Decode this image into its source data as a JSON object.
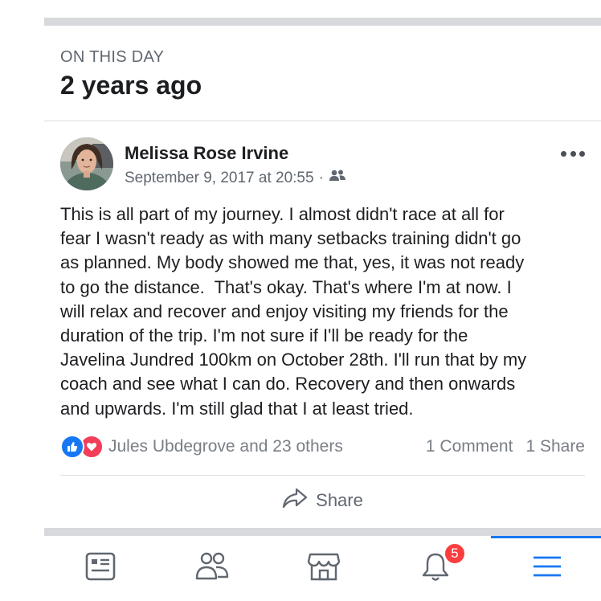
{
  "section": {
    "label": "ON THIS DAY",
    "title": "2 years ago"
  },
  "post": {
    "author": "Melissa Rose Irvine",
    "timestamp": "September 9, 2017 at 20:55",
    "separator": "·",
    "audience_icon": "friends-icon",
    "more_icon": "more-options-icon",
    "body": "This is all part of my journey. I almost didn't race at all for\nfear I wasn't ready as with many setbacks training didn't go\nas planned. My body showed me that, yes, it was not ready\nto go the distance.  That's okay. That's where I'm at now. I\nwill relax and recover and enjoy visiting my friends for the\nduration of the trip. I'm not sure if I'll be ready for the\nJavelina Jundred 100km on October 28th. I'll run that by my\ncoach and see what I can do. Recovery and then onwards\nand upwards. I'm still glad that I at least tried.",
    "reactions": {
      "icons": [
        "like-icon",
        "love-icon"
      ],
      "names": "Jules Ubdegrove and 23 others",
      "comments": "1 Comment",
      "shares": "1 Share"
    },
    "share_action": {
      "icon": "share-arrow-icon",
      "label": "Share"
    }
  },
  "tabbar": {
    "tabs": [
      {
        "name": "news-feed",
        "icon": "news-feed-icon"
      },
      {
        "name": "friends",
        "icon": "friends-tab-icon"
      },
      {
        "name": "marketplace",
        "icon": "marketplace-icon"
      },
      {
        "name": "notifications",
        "icon": "bell-icon",
        "badge": "5"
      },
      {
        "name": "menu",
        "icon": "hamburger-menu-icon",
        "active": true
      }
    ]
  },
  "colors": {
    "accent": "#1877f2",
    "badge": "#fa3e3e",
    "love": "#f33e58",
    "divider": "#d8d9dc",
    "secondary_text": "#606770"
  }
}
